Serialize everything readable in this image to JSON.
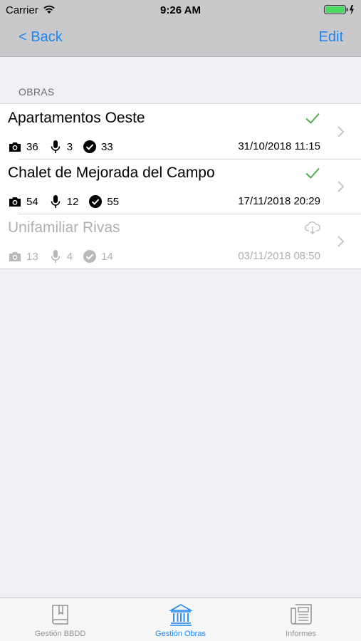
{
  "status_bar": {
    "carrier": "Carrier",
    "time": "9:26 AM"
  },
  "nav": {
    "back_label": "< Back",
    "edit_label": "Edit"
  },
  "section": {
    "header": "OBRAS"
  },
  "obras": [
    {
      "title": "Apartamentos Oeste",
      "photos": "36",
      "audios": "3",
      "checks": "33",
      "date": "31/10/2018 11:15",
      "status": "check-icon"
    },
    {
      "title": "Chalet de Mejorada del Campo",
      "photos": "54",
      "audios": "12",
      "checks": "55",
      "date": "17/11/2018 20:29",
      "status": "check-icon"
    },
    {
      "title": "Unifamiliar Rivas",
      "photos": "13",
      "audios": "4",
      "checks": "14",
      "date": "03/11/2018 08:50",
      "status": "cloud-download-icon"
    }
  ],
  "tabs": [
    {
      "label": "Gestión BBDD",
      "icon": "book-icon"
    },
    {
      "label": "Gestión Obras",
      "icon": "building-icon"
    },
    {
      "label": "Informes",
      "icon": "newspaper-icon"
    }
  ],
  "colors": {
    "accent": "#1a86f4",
    "check": "#4cae4f",
    "disabled": "#b0b0b0",
    "battery": "#4cd964"
  }
}
